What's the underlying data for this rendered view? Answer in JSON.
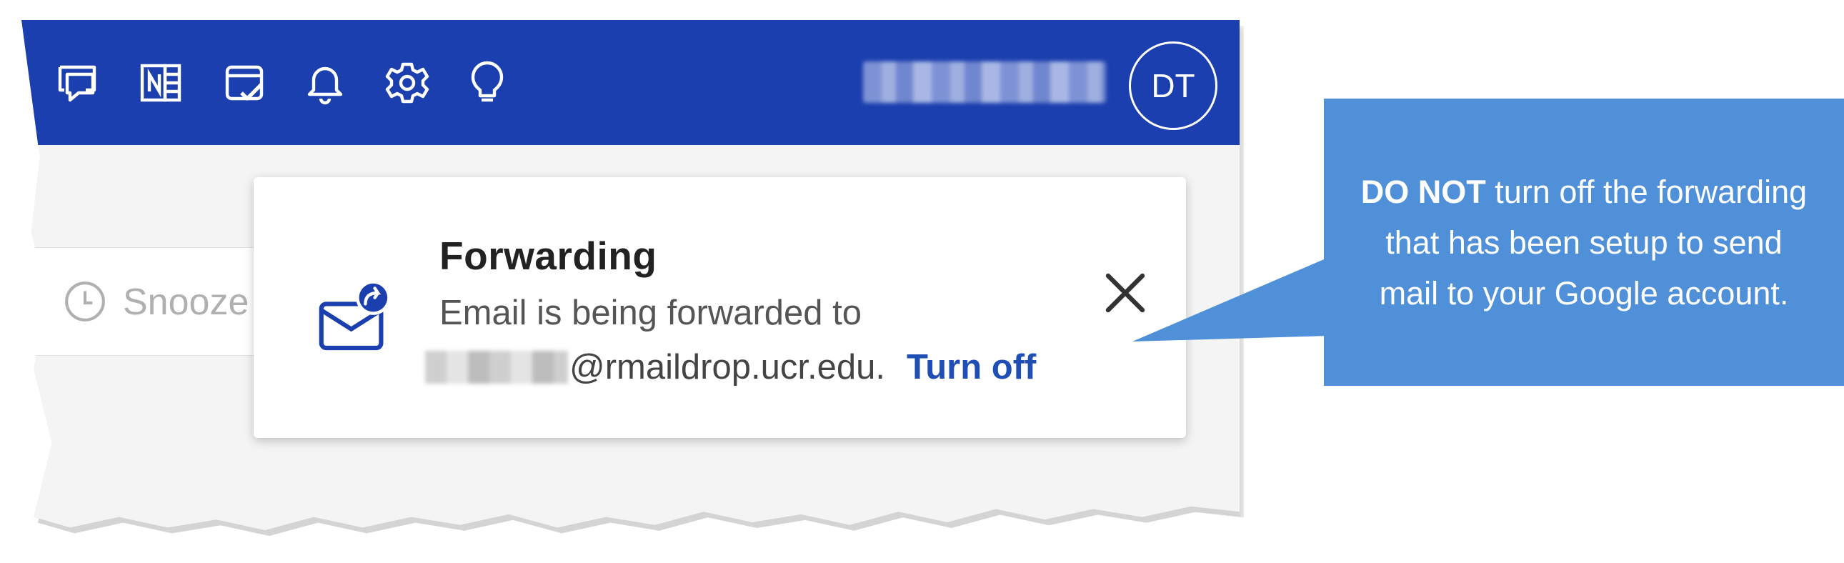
{
  "topbar": {
    "icons": [
      {
        "name": "feedback-chat-icon"
      },
      {
        "name": "onenote-icon"
      },
      {
        "name": "my-day-icon"
      },
      {
        "name": "notifications-bell-icon"
      },
      {
        "name": "settings-gear-icon"
      },
      {
        "name": "tips-lightbulb-icon"
      }
    ],
    "avatar_initials": "DT"
  },
  "toolbar": {
    "snooze_label": "Snooze"
  },
  "forwarding_notice": {
    "title": "Forwarding",
    "description": "Email is being forwarded to",
    "email_domain": "@rmaildrop.ucr.edu.",
    "turn_off_label": "Turn off"
  },
  "callout": {
    "bold_text": "DO NOT",
    "text": " turn off the forwarding that has been setup to send mail to your Google account."
  },
  "colors": {
    "topbar": "#1b3fae",
    "link": "#1f4fb5",
    "callout": "#4f90d8"
  }
}
